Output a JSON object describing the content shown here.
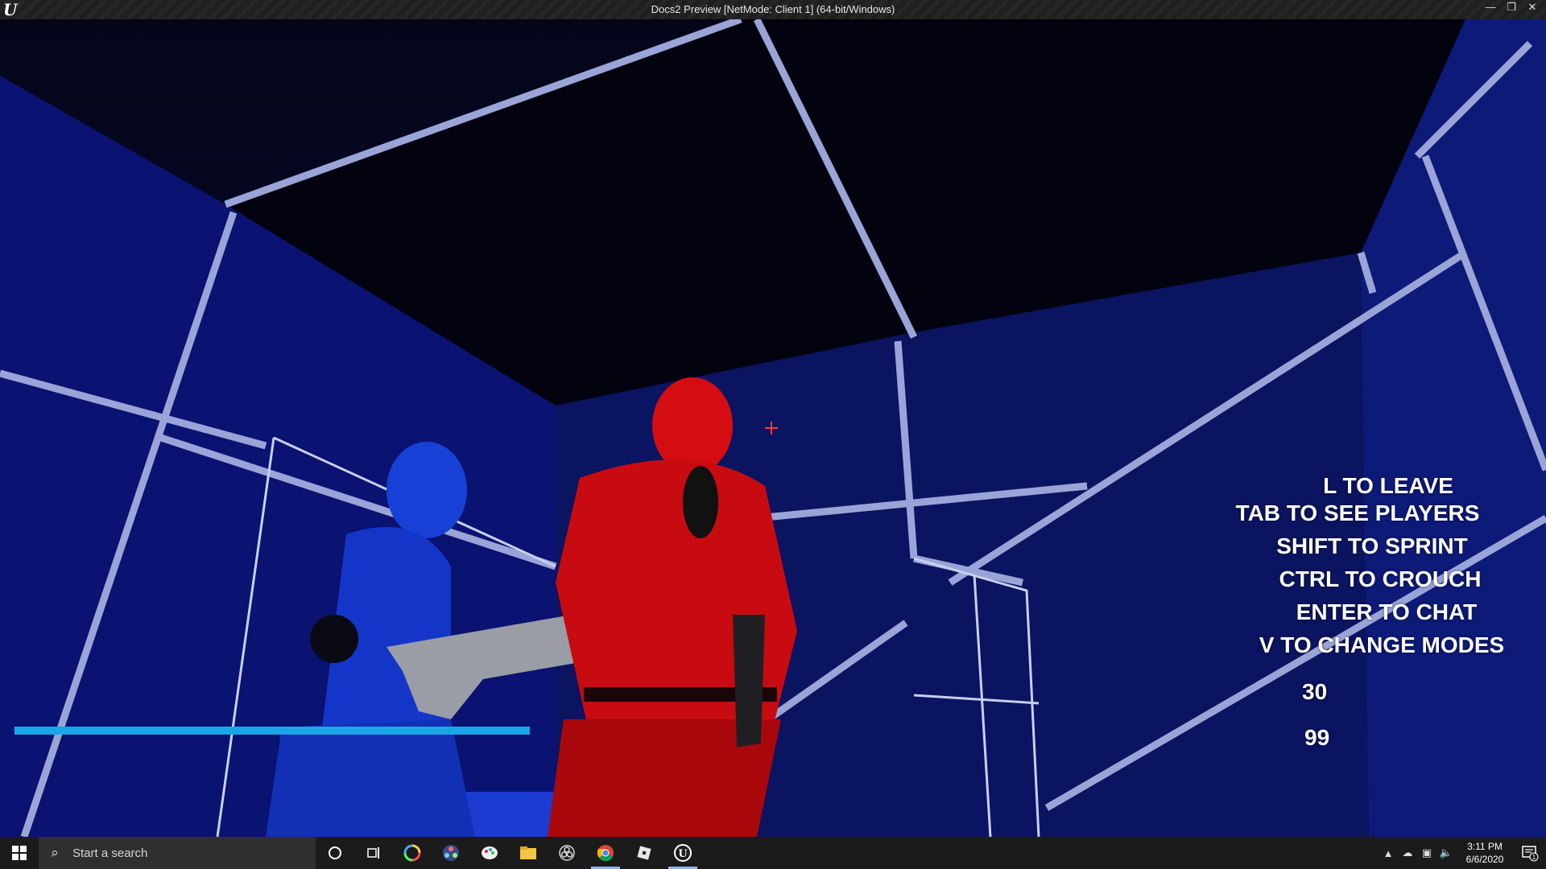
{
  "window": {
    "title": "Docs2 Preview [NetMode: Client 1] (64-bit/Windows)",
    "logo_text": "U",
    "minimize_glyph": "—",
    "restore_glyph": "❐",
    "close_glyph": "✕"
  },
  "hud": {
    "hints": [
      "L TO LEAVE",
      "TAB TO SEE PLAYERS",
      "SHIFT TO SPRINT",
      "CTRL TO CROUCH",
      "ENTER TO CHAT",
      "V TO CHANGE MODES"
    ],
    "ammo": "30",
    "health": "99",
    "health_fraction": 1.0,
    "health_color": "#1aa6e6",
    "crosshair_color": "#ff3a3a"
  },
  "taskbar": {
    "search_placeholder": "Start a search",
    "clock_time": "3:11 PM",
    "clock_date": "6/6/2020",
    "notification_count": "1",
    "apps": [
      "cortana-icon",
      "task-view-icon",
      "color-wheel-icon",
      "davinci-resolve-icon",
      "paint-icon",
      "file-explorer-icon",
      "obs-icon",
      "chrome-icon",
      "roblox-icon",
      "unreal-engine-icon"
    ]
  }
}
